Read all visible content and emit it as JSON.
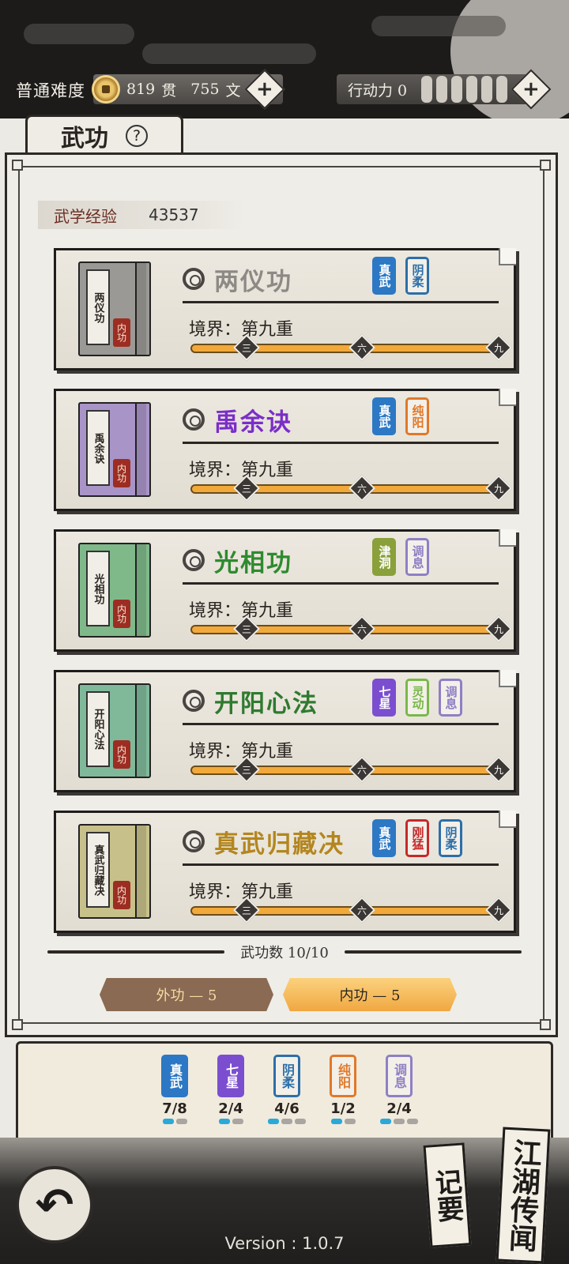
{
  "hud": {
    "difficulty": "普通难度",
    "money_amount_1": "819",
    "money_unit_1": "贯",
    "money_amount_2": "755",
    "money_unit_2": "文",
    "action_label": "行动力 0",
    "plus": "+",
    "action_bar_count": 6
  },
  "title": {
    "text": "武功",
    "help": "?"
  },
  "experience": {
    "label": "武学经验",
    "value": "43537"
  },
  "skills": [
    {
      "name": "两仪功",
      "book_title": "两仪功",
      "seal": "内功",
      "realm": "境界：第九重",
      "name_color": "#8d8a86",
      "book_color": "#9b9995",
      "tags": [
        {
          "text": "真武",
          "color": "#2c78c4",
          "filled": true
        },
        {
          "text": "阴柔",
          "color": "#2c6fa8",
          "filled": false
        }
      ]
    },
    {
      "name": "禹余诀",
      "book_title": "禹余诀",
      "seal": "内功",
      "realm": "境界：第九重",
      "name_color": "#7a2ec8",
      "book_color": "#a994c8",
      "tags": [
        {
          "text": "真武",
          "color": "#2c78c4",
          "filled": true
        },
        {
          "text": "纯阳",
          "color": "#e0792a",
          "filled": false
        }
      ]
    },
    {
      "name": "光相功",
      "book_title": "光相功",
      "seal": "内功",
      "realm": "境界：第九重",
      "name_color": "#2f8a2f",
      "book_color": "#7fb98a",
      "tags": [
        {
          "text": "津洞",
          "color": "#8aa03a",
          "filled": true
        },
        {
          "text": "调息",
          "color": "#8f7fc4",
          "filled": false
        }
      ]
    },
    {
      "name": "开阳心法",
      "book_title": "开阳心法",
      "seal": "内功",
      "realm": "境界：第九重",
      "name_color": "#2f7a2f",
      "book_color": "#7fb99a",
      "tags": [
        {
          "text": "七星",
          "color": "#7b4ed0",
          "filled": true
        },
        {
          "text": "灵动",
          "color": "#7ab84a",
          "filled": false
        },
        {
          "text": "调息",
          "color": "#8f7fc4",
          "filled": false
        }
      ]
    },
    {
      "name": "真武归藏决",
      "book_title": "真武归藏决",
      "seal": "内功",
      "realm": "境界：第九重",
      "name_color": "#b3861f",
      "book_color": "#c7c08a",
      "tags": [
        {
          "text": "真武",
          "color": "#2c78c4",
          "filled": true
        },
        {
          "text": "刚猛",
          "color": "#c42a2a",
          "filled": false
        },
        {
          "text": "阴柔",
          "color": "#2c6fa8",
          "filled": false
        }
      ]
    }
  ],
  "progress_marks": [
    "三",
    "六",
    "九"
  ],
  "skill_level": 9,
  "skill_level_max": 9,
  "count_label": "武功数 10/10",
  "tabs": {
    "outer": "外功 — 5",
    "inner": "内功 — 5"
  },
  "bonuses": [
    {
      "text": "真武",
      "color": "#2c78c4",
      "filled": true,
      "count": "7/8",
      "pips": [
        1,
        0
      ]
    },
    {
      "text": "七星",
      "color": "#7b4ed0",
      "filled": true,
      "count": "2/4",
      "pips": [
        1,
        0
      ]
    },
    {
      "text": "阴柔",
      "color": "#2c6fa8",
      "filled": false,
      "count": "4/6",
      "pips": [
        1,
        0,
        0
      ]
    },
    {
      "text": "纯阳",
      "color": "#e0792a",
      "filled": false,
      "count": "1/2",
      "pips": [
        1,
        0
      ]
    },
    {
      "text": "调息",
      "color": "#8f7fc4",
      "filled": false,
      "count": "2/4",
      "pips": [
        1,
        0,
        0
      ]
    }
  ],
  "side_cards": {
    "notes": "记要",
    "rumors": "江湖传闻"
  },
  "back_icon": "↶",
  "version": "Version : 1.0.7"
}
